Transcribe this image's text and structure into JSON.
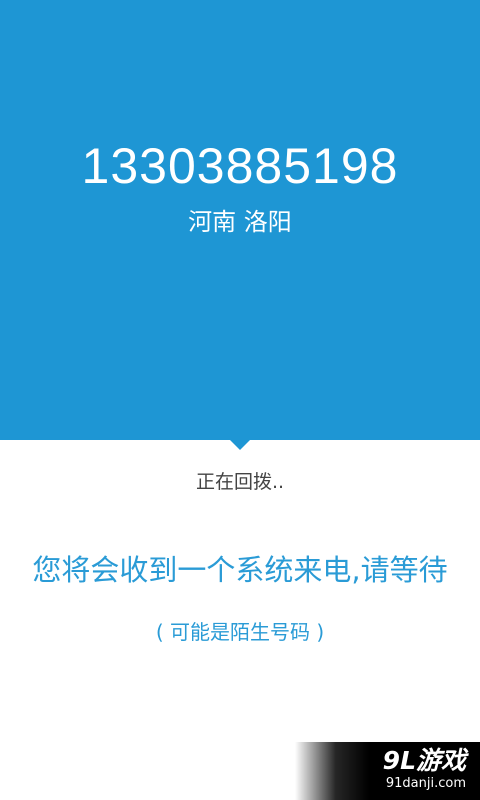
{
  "call": {
    "phone_number": "13303885198",
    "location": "河南 洛阳",
    "status": "正在回拨.."
  },
  "message": {
    "main": "您将会收到一个系统来电,请等待",
    "sub": "( 可能是陌生号码 )"
  },
  "watermark": {
    "logo": "9L游戏",
    "url": "91danji.com"
  },
  "colors": {
    "accent": "#1e96d4",
    "message_text": "#2a9bd6"
  }
}
